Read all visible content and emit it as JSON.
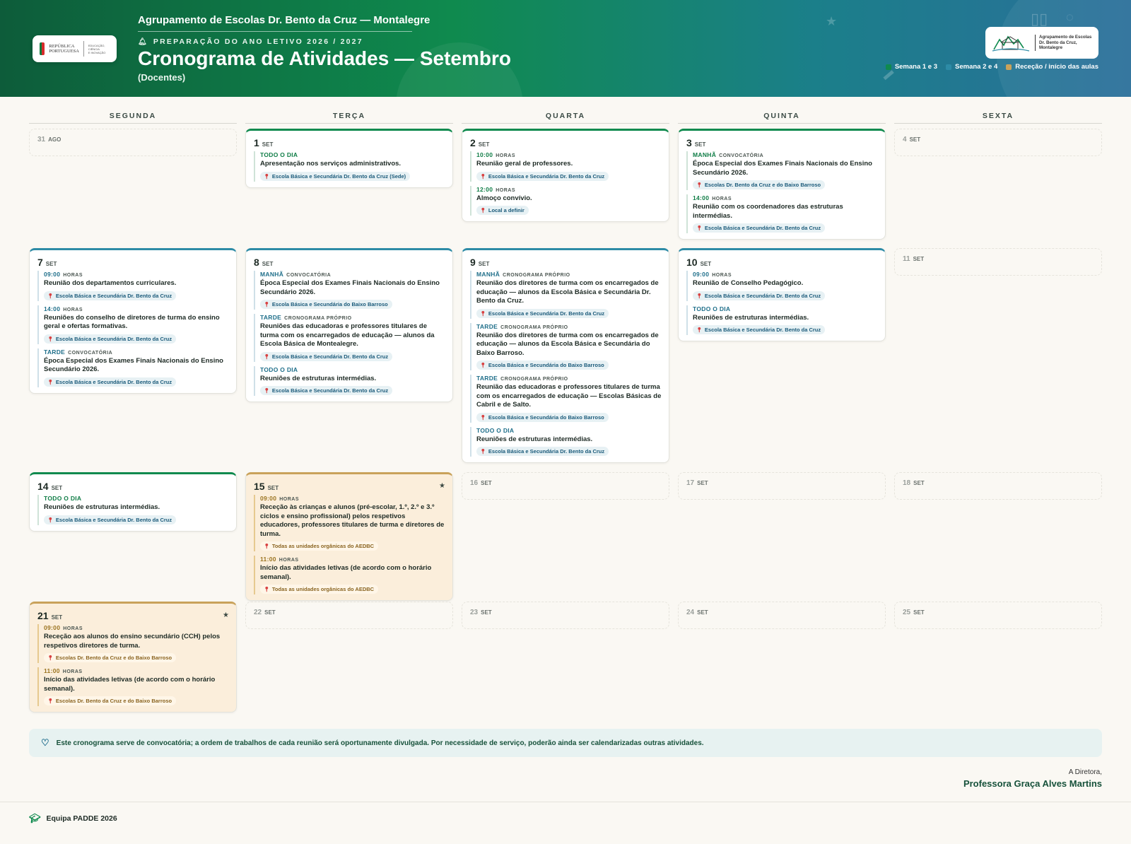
{
  "header": {
    "school": "Agrupamento de Escolas Dr. Bento da Cruz — Montalegre",
    "prep": "PREPARAÇÃO DO ANO LETIVO 2026 / 2027",
    "title": "Cronograma de Atividades — Setembro",
    "subtitle": "(Docentes)",
    "gov_logo": {
      "line1": "REPÚBLICA",
      "line2": "PORTUGUESA",
      "small1": "EDUCAÇÃO, CIÊNCIA",
      "small2": "E INOVAÇÃO"
    },
    "school_logo": {
      "line1": "Agrupamento de Escolas",
      "line2": "Dr. Bento da Cruz,",
      "line3": "Montalegre"
    },
    "legend": [
      {
        "label": "Semana 1 e 3",
        "color": "#0f8a4e"
      },
      {
        "label": "Semana 2 e 4",
        "color": "#2d8ba6"
      },
      {
        "label": "Receção / início das aulas",
        "color": "#c9a25a"
      }
    ]
  },
  "days": [
    "SEGUNDA",
    "TERÇA",
    "QUARTA",
    "QUINTA",
    "SEXTA"
  ],
  "weeks": [
    {
      "cells": [
        {
          "n": "31",
          "m": "AGO",
          "empty": true
        },
        {
          "n": "1",
          "m": "SET",
          "style": "green",
          "events": [
            {
              "time": "TODO O DIA",
              "title": "Apresentação nos serviços administrativos.",
              "loc": "Escola Básica e Secundária Dr. Bento da Cruz (Sede)"
            }
          ]
        },
        {
          "n": "2",
          "m": "SET",
          "style": "green",
          "events": [
            {
              "time": "10:00",
              "kind": "HORAS",
              "title": "Reunião geral de professores.",
              "loc": "Escola Básica e Secundária Dr. Bento da Cruz"
            },
            {
              "time": "12:00",
              "kind": "HORAS",
              "title": "Almoço convívio.",
              "loc": "Local a definir"
            }
          ]
        },
        {
          "n": "3",
          "m": "SET",
          "style": "green",
          "events": [
            {
              "time": "MANHÃ",
              "kind": "CONVOCATÓRIA",
              "title": "Época Especial dos Exames Finais Nacionais do Ensino Secundário 2026.",
              "loc": "Escolas Dr. Bento da Cruz e do Baixo Barroso"
            },
            {
              "time": "14:00",
              "kind": "HORAS",
              "title": "Reunião com os coordenadores das estruturas intermédias.",
              "loc": "Escola Básica e Secundária Dr. Bento da Cruz"
            }
          ]
        },
        {
          "n": "4",
          "m": "SET",
          "empty": true
        }
      ]
    },
    {
      "cells": [
        {
          "n": "7",
          "m": "SET",
          "style": "blue",
          "events": [
            {
              "time": "09:00",
              "kind": "HORAS",
              "title": "Reunião dos departamentos curriculares.",
              "loc": "Escola Básica e Secundária Dr. Bento da Cruz"
            },
            {
              "time": "14:00",
              "kind": "HORAS",
              "title": "Reuniões do conselho de diretores de turma do ensino geral e ofertas formativas.",
              "loc": "Escola Básica e Secundária Dr. Bento da Cruz"
            },
            {
              "time": "TARDE",
              "kind": "CONVOCATÓRIA",
              "title": "Época Especial dos Exames Finais Nacionais do Ensino Secundário 2026.",
              "loc": "Escola Básica e Secundária Dr. Bento da Cruz"
            }
          ]
        },
        {
          "n": "8",
          "m": "SET",
          "style": "blue",
          "events": [
            {
              "time": "MANHÃ",
              "kind": "CONVOCATÓRIA",
              "title": "Época Especial dos Exames Finais Nacionais do Ensino Secundário 2026.",
              "loc": "Escola Básica e Secundária do Baixo Barroso"
            },
            {
              "time": "TARDE",
              "kind": "CRONOGRAMA PRÓPRIO",
              "title": "Reuniões das educadoras e professores titulares de turma com os encarregados de educação — alunos da Escola Básica de Montealegre.",
              "loc": "Escola Básica e Secundária Dr. Bento da Cruz"
            },
            {
              "time": "TODO O DIA",
              "title": "Reuniões de estruturas intermédias.",
              "loc": "Escola Básica e Secundária Dr. Bento da Cruz"
            }
          ]
        },
        {
          "n": "9",
          "m": "SET",
          "style": "blue",
          "events": [
            {
              "time": "MANHÃ",
              "kind": "CRONOGRAMA PRÓPRIO",
              "title": "Reunião dos diretores de turma com os encarregados de educação — alunos da Escola Básica e Secundária Dr. Bento da Cruz.",
              "loc": "Escola Básica e Secundária Dr. Bento da Cruz"
            },
            {
              "time": "TARDE",
              "kind": "CRONOGRAMA PRÓPRIO",
              "title": "Reunião dos diretores de turma com os encarregados de educação — alunos da Escola Básica e Secundária do Baixo Barroso.",
              "loc": "Escola Básica e Secundária do Baixo Barroso"
            },
            {
              "time": "TARDE",
              "kind": "CRONOGRAMA PRÓPRIO",
              "title": "Reunião das educadoras e professores titulares de turma com os encarregados de educação — Escolas Básicas de Cabril e de Salto.",
              "loc": "Escola Básica e Secundária do Baixo Barroso"
            },
            {
              "time": "TODO O DIA",
              "title": "Reuniões de estruturas intermédias.",
              "loc": "Escola Básica e Secundária Dr. Bento da Cruz"
            }
          ]
        },
        {
          "n": "10",
          "m": "SET",
          "style": "blue",
          "events": [
            {
              "time": "09:00",
              "kind": "HORAS",
              "title": "Reunião de Conselho Pedagógico.",
              "loc": "Escola Básica e Secundária Dr. Bento da Cruz"
            },
            {
              "time": "TODO O DIA",
              "title": "Reuniões de estruturas intermédias.",
              "loc": "Escola Básica e Secundária Dr. Bento da Cruz"
            }
          ]
        },
        {
          "n": "11",
          "m": "SET",
          "empty": true
        }
      ]
    },
    {
      "cells": [
        {
          "n": "14",
          "m": "SET",
          "style": "green",
          "events": [
            {
              "time": "TODO O DIA",
              "title": "Reuniões de estruturas intermédias.",
              "loc": "Escola Básica e Secundária Dr. Bento da Cruz"
            }
          ]
        },
        {
          "n": "15",
          "m": "SET",
          "style": "gold",
          "star": "★",
          "events": [
            {
              "time": "09:00",
              "kind": "HORAS",
              "title": "Receção às crianças e alunos (pré-escolar, 1.º, 2.º e 3.º ciclos e ensino profissional) pelos respetivos educadores, professores titulares de turma e diretores de turma.",
              "loc": "Todas as unidades orgânicas do AEDBC"
            },
            {
              "time": "11:00",
              "kind": "HORAS",
              "title": "Início das atividades letivas (de acordo com o horário semanal).",
              "loc": "Todas as unidades orgânicas do AEDBC"
            }
          ]
        },
        {
          "n": "16",
          "m": "SET",
          "empty": true
        },
        {
          "n": "17",
          "m": "SET",
          "empty": true
        },
        {
          "n": "18",
          "m": "SET",
          "empty": true
        }
      ]
    },
    {
      "cells": [
        {
          "n": "21",
          "m": "SET",
          "style": "gold",
          "star": "★",
          "events": [
            {
              "time": "09:00",
              "kind": "HORAS",
              "title": "Receção aos alunos do ensino secundário (CCH) pelos respetivos diretores de turma.",
              "loc": "Escolas Dr. Bento da Cruz e do Baixo Barroso"
            },
            {
              "time": "11:00",
              "kind": "HORAS",
              "title": "Início das atividades letivas (de acordo com o horário semanal).",
              "loc": "Escolas Dr. Bento da Cruz e do Baixo Barroso"
            }
          ]
        },
        {
          "n": "22",
          "m": "SET",
          "empty": true
        },
        {
          "n": "23",
          "m": "SET",
          "empty": true
        },
        {
          "n": "24",
          "m": "SET",
          "empty": true
        },
        {
          "n": "25",
          "m": "SET",
          "empty": true
        }
      ]
    }
  ],
  "note": "Este cronograma serve de convocatória; a ordem de trabalhos de cada reunião será oportunamente divulgada. Por necessidade de serviço, poderão ainda ser calendarizadas outras atividades.",
  "signature": {
    "role": "A Diretora,",
    "name": "Professora Graça Alves Martins"
  },
  "footer": {
    "team": "Equipa PADDE 2026"
  }
}
